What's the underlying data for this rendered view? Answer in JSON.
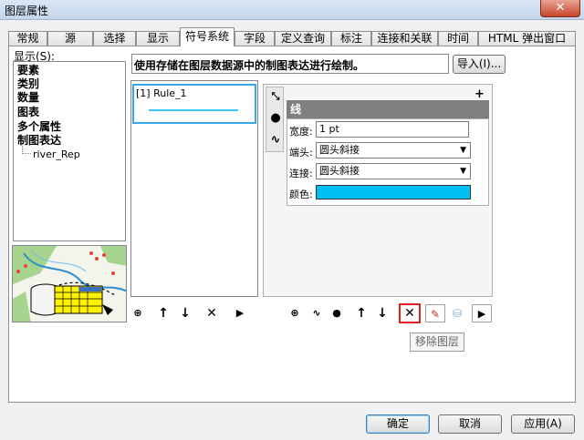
{
  "window": {
    "title": "图层属性",
    "close_glyph": "✕"
  },
  "tabs": [
    "常规",
    "源",
    "选择",
    "显示",
    "符号系统",
    "字段",
    "定义查询",
    "标注",
    "连接和关联",
    "时间",
    "HTML 弹出窗口"
  ],
  "left": {
    "show_label": "显示(S):",
    "categories": [
      "要素",
      "类别",
      "数量",
      "图表",
      "多个属性",
      "制图表达"
    ],
    "sub_item": "river_Rep"
  },
  "header": {
    "description": "使用存储在图层数据源中的制图表达进行绘制。",
    "import_button": "导入(I)..."
  },
  "rules": {
    "item": "[1] Rule_1"
  },
  "symbol": {
    "header": "线",
    "plus": "+",
    "width_label": "宽度:",
    "width_value": "1 pt",
    "cap_label": "端头:",
    "cap_value": "圆头斜接",
    "join_label": "连接:",
    "join_value": "圆头斜接",
    "color_label": "颜色:",
    "color_value": "#00bff3"
  },
  "tooltip": "移除图层",
  "footer": {
    "ok": "确定",
    "cancel": "取消",
    "apply": "应用(A)"
  }
}
